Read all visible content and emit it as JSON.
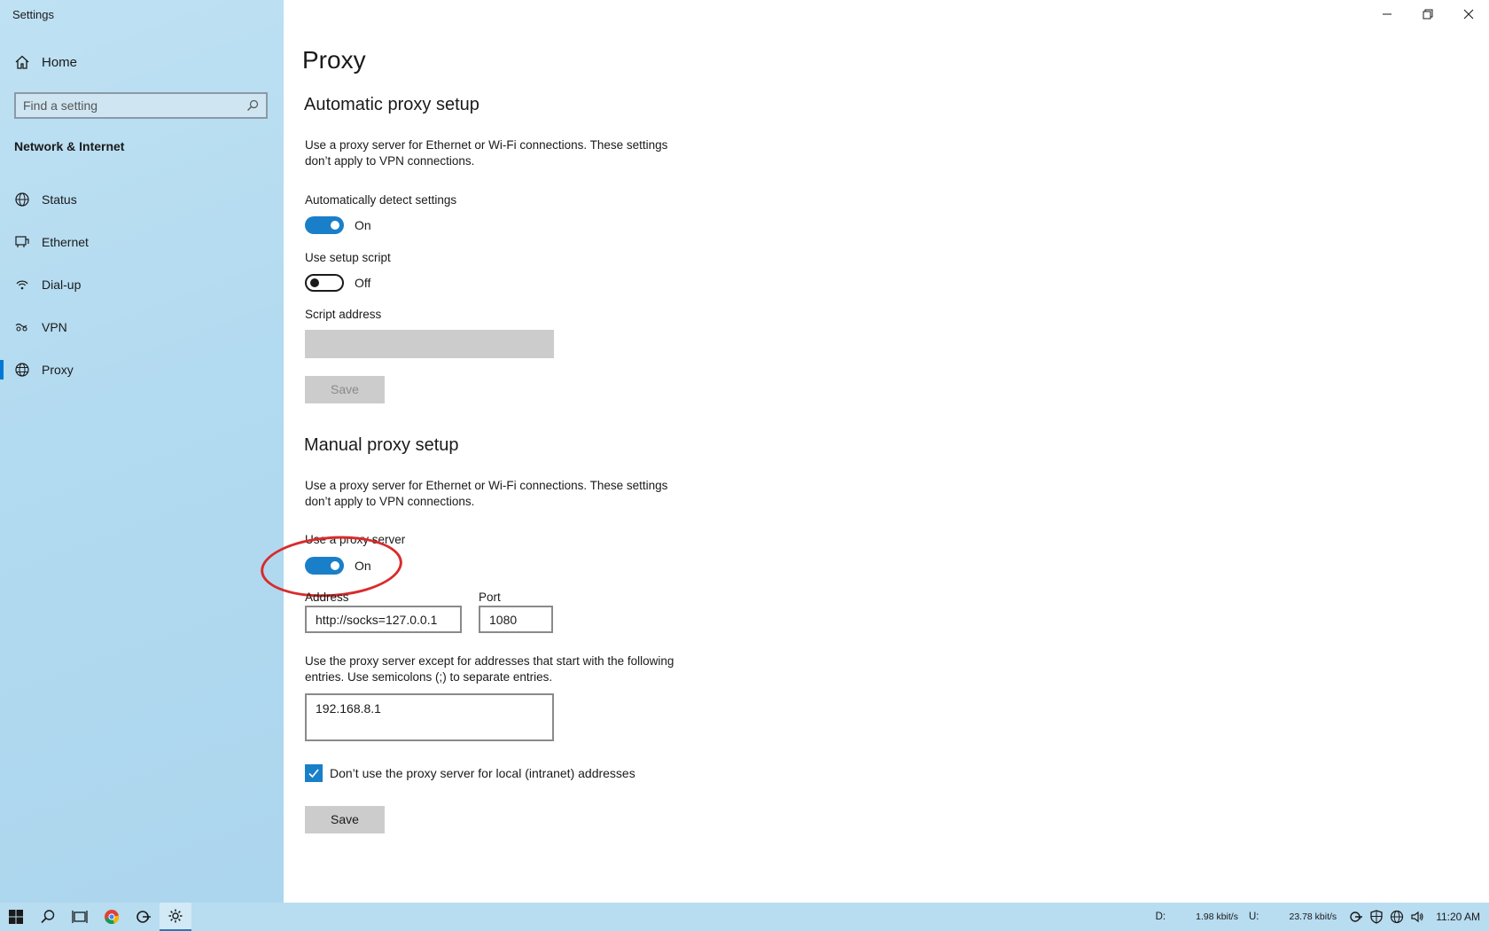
{
  "window": {
    "title": "Settings"
  },
  "sidebar": {
    "home_label": "Home",
    "search_placeholder": "Find a setting",
    "section_title": "Network & Internet",
    "items": [
      {
        "label": "Status",
        "icon": "globe-status-icon"
      },
      {
        "label": "Ethernet",
        "icon": "ethernet-icon"
      },
      {
        "label": "Dial-up",
        "icon": "dial-up-icon"
      },
      {
        "label": "VPN",
        "icon": "vpn-icon"
      },
      {
        "label": "Proxy",
        "icon": "globe-icon",
        "active": true
      }
    ]
  },
  "main": {
    "title": "Proxy",
    "auto": {
      "heading": "Automatic proxy setup",
      "description": "Use a proxy server for Ethernet or Wi-Fi connections. These settings don’t apply to VPN connections.",
      "detect_label": "Automatically detect settings",
      "detect_state": "On",
      "script_label": "Use setup script",
      "script_state": "Off",
      "address_label": "Script address",
      "address_value": "",
      "save_label": "Save"
    },
    "manual": {
      "heading": "Manual proxy setup",
      "description": "Use a proxy server for Ethernet or Wi-Fi connections. These settings don’t apply to VPN connections.",
      "use_proxy_label": "Use a proxy server",
      "use_proxy_state": "On",
      "address_label": "Address",
      "address_value": "http://socks=127.0.0.1",
      "port_label": "Port",
      "port_value": "1080",
      "exceptions_description": "Use the proxy server except for addresses that start with the following entries. Use semicolons (;) to separate entries.",
      "exceptions_value": "192.168.8.1",
      "local_checkbox_label": "Don’t use the proxy server for local (intranet) addresses",
      "local_checked": true,
      "save_label": "Save"
    }
  },
  "taskbar": {
    "apps": [
      "windows-start-icon",
      "search-icon",
      "task-view-icon",
      "chrome-icon",
      "vpn-client-icon",
      "settings-gear-icon"
    ],
    "down_label": "D:",
    "down_value": "1.98 kbit/s",
    "up_label": "U:",
    "up_value": "23.78 kbit/s",
    "time": "11:20 AM"
  },
  "colors": {
    "accent": "#1a7fc9",
    "sidebar_bg": "#b2daf0",
    "highlight": "#d92b2b"
  }
}
